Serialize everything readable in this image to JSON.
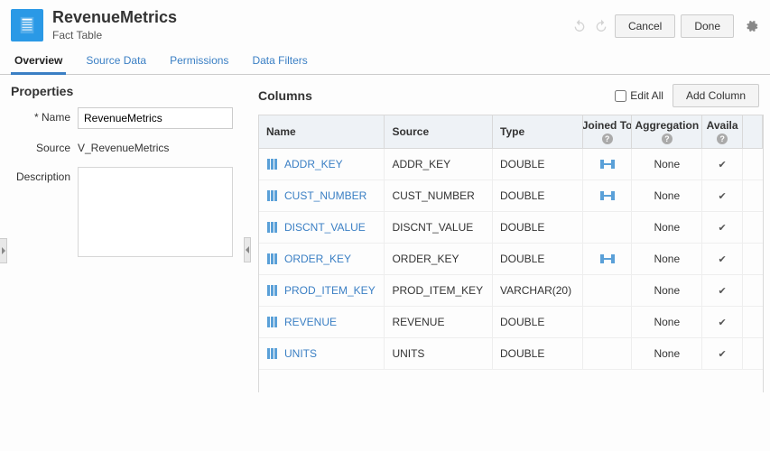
{
  "header": {
    "title": "RevenueMetrics",
    "subtitle": "Fact Table",
    "cancel": "Cancel",
    "done": "Done"
  },
  "tabs": {
    "overview": "Overview",
    "source_data": "Source Data",
    "permissions": "Permissions",
    "data_filters": "Data Filters"
  },
  "properties": {
    "heading": "Properties",
    "name_label": "Name",
    "name_value": "RevenueMetrics",
    "source_label": "Source",
    "source_value": "V_RevenueMetrics",
    "description_label": "Description",
    "description_value": ""
  },
  "columns": {
    "heading": "Columns",
    "edit_all": "Edit All",
    "add_column": "Add Column",
    "headers": {
      "name": "Name",
      "source": "Source",
      "type": "Type",
      "joined": "Joined To",
      "aggregation": "Aggregation",
      "available": "Availa"
    },
    "rows": [
      {
        "name": "ADDR_KEY",
        "source": "ADDR_KEY",
        "type": "DOUBLE",
        "joined": true,
        "aggregation": "None",
        "available": true
      },
      {
        "name": "CUST_NUMBER",
        "source": "CUST_NUMBER",
        "type": "DOUBLE",
        "joined": true,
        "aggregation": "None",
        "available": true
      },
      {
        "name": "DISCNT_VALUE",
        "source": "DISCNT_VALUE",
        "type": "DOUBLE",
        "joined": false,
        "aggregation": "None",
        "available": true
      },
      {
        "name": "ORDER_KEY",
        "source": "ORDER_KEY",
        "type": "DOUBLE",
        "joined": true,
        "aggregation": "None",
        "available": true
      },
      {
        "name": "PROD_ITEM_KEY",
        "source": "PROD_ITEM_KEY",
        "type": "VARCHAR(20)",
        "joined": false,
        "aggregation": "None",
        "available": true
      },
      {
        "name": "REVENUE",
        "source": "REVENUE",
        "type": "DOUBLE",
        "joined": false,
        "aggregation": "None",
        "available": true
      },
      {
        "name": "UNITS",
        "source": "UNITS",
        "type": "DOUBLE",
        "joined": false,
        "aggregation": "None",
        "available": true
      }
    ]
  }
}
